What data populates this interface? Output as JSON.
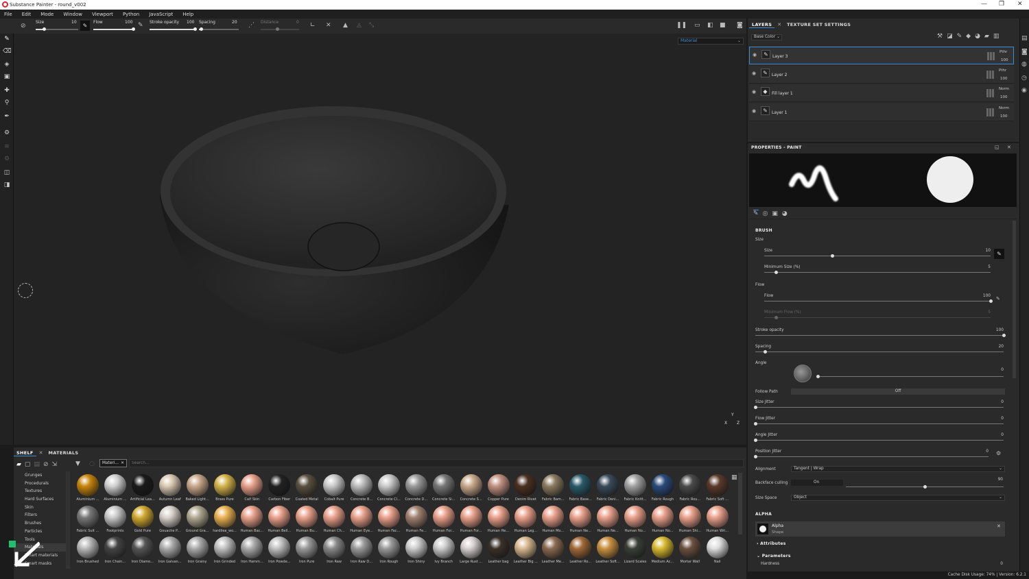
{
  "title_bar": {
    "title": "Substance Painter - round_v002",
    "minimize": "—",
    "maximize": "❐",
    "close": "✕"
  },
  "menu": [
    "File",
    "Edit",
    "Mode",
    "Window",
    "Viewport",
    "Python",
    "JavaScript",
    "Help"
  ],
  "toolbar": {
    "size_label": "Size",
    "size_value": "10",
    "size_level": 0.2,
    "flow_label": "Flow",
    "flow_value": "100",
    "flow_level": 1.0,
    "stroke_opacity_label": "Stroke opacity",
    "stroke_opacity_value": "100",
    "stroke_opacity_level": 1.0,
    "spacing_label": "Spacing",
    "spacing_value": "20",
    "spacing_level": 0.05,
    "distance_label": "Distance",
    "distance_value": "0"
  },
  "viewport": {
    "mode_select": "Material",
    "gizmo_y": "Y",
    "gizmo_x": "X",
    "gizmo_z": "Z"
  },
  "layers_panel": {
    "tab_layers": "LAYERS",
    "tab_texture_set": "TEXTURE SET SETTINGS",
    "channel_select": "Base Color",
    "layers": [
      {
        "name": "Layer 3",
        "blend": "Pthr",
        "opacity": "100",
        "selected": true,
        "type": "paint"
      },
      {
        "name": "Layer 2",
        "blend": "Pthr",
        "opacity": "100",
        "selected": false,
        "type": "paint"
      },
      {
        "name": "Fill layer 1",
        "blend": "Norm",
        "opacity": "100",
        "selected": false,
        "type": "fill"
      },
      {
        "name": "Layer 1",
        "blend": "Norm",
        "opacity": "100",
        "selected": false,
        "type": "paint"
      }
    ]
  },
  "properties": {
    "header": "PROPERTIES - PAINT",
    "brush_header": "BRUSH",
    "size_group": "Size",
    "size": {
      "label": "Size",
      "value": "10",
      "level": 0.3
    },
    "min_size": {
      "label": "Minimum Size (%)",
      "value": "5",
      "level": 0.05
    },
    "flow_group": "Flow",
    "flow": {
      "label": "Flow",
      "value": "100",
      "level": 1.0
    },
    "min_flow": {
      "label": "Minimum Flow (%)",
      "value": "5",
      "level": 0.05
    },
    "stroke_opacity": {
      "label": "Stroke opacity",
      "value": "100",
      "level": 1.0
    },
    "spacing": {
      "label": "Spacing",
      "value": "20",
      "level": 0.04
    },
    "angle": {
      "label": "Angle",
      "value": "0",
      "level": 0.0
    },
    "follow_path": {
      "label": "Follow Path",
      "value": "Off"
    },
    "size_jitter": {
      "label": "Size Jitter",
      "value": "0",
      "level": 0.0
    },
    "flow_jitter": {
      "label": "Flow Jitter",
      "value": "0",
      "level": 0.0
    },
    "angle_jitter": {
      "label": "Angle Jitter",
      "value": "0",
      "level": 0.0
    },
    "position_jitter": {
      "label": "Position Jitter",
      "value": "0",
      "level": 0.0
    },
    "alignment": {
      "label": "Alignment",
      "value": "Tangent | Wrap"
    },
    "backface_culling": {
      "label": "Backface culling",
      "toggle": "On",
      "value": "90",
      "level": 0.5
    },
    "size_space": {
      "label": "Size Space",
      "value": "Object"
    },
    "alpha_header": "ALPHA",
    "alpha": {
      "name": "Alpha",
      "sub": "Shape"
    },
    "attributes": "Attributes",
    "parameters": "Parameters",
    "hardness": {
      "label": "Hardness",
      "value": "0"
    }
  },
  "shelf": {
    "tab_shelf": "SHELF",
    "tab_materials": "MATERIALS",
    "filter_chip": "Materi...",
    "search_placeholder": "Search...",
    "categories": [
      "Grunges",
      "Procedurals",
      "Textures",
      "Hard Surfaces",
      "Skin",
      "Filters",
      "Brushes",
      "Particles",
      "Tools",
      "Materials",
      "Smart materials",
      "Smart masks"
    ],
    "selected_category": 9,
    "materials_row1": [
      "Aluminium ...",
      "Aluminium ...",
      "Artificial Lea...",
      "Autumn Leaf",
      "Baked Light...",
      "Brass Pure",
      "Calf Skin",
      "Carbon Fiber",
      "Coated Metal",
      "Cobalt Pure",
      "Concrete B...",
      "Concrete Cl...",
      "Concrete D...",
      "Concrete Si...",
      "Concrete S...",
      "Copper Pure",
      "Denim Rivet",
      "Fabric Bam...",
      "Fabric Base...",
      "Fabric Deni...",
      "Fabric Knitt...",
      "Fabric Rough",
      "Fabric Rou...",
      "Fabric Soft ..."
    ],
    "materials_row2": [
      "Fabric Suit ...",
      "Footprints",
      "Gold Pure",
      "Gouache P...",
      "Ground Gra...",
      "hardilea_wo...",
      "Human Bac...",
      "Human Bell...",
      "Human Bu...",
      "Human Ch...",
      "Human Eye...",
      "Human Fac...",
      "Human Fe...",
      "Human For...",
      "Human For...",
      "Human He...",
      "Human Leg...",
      "Human Mo...",
      "Human Ne...",
      "Human Ne...",
      "Human No...",
      "Human No...",
      "Human Shi...",
      "Human Wri..."
    ],
    "materials_row3": [
      "Iron Brushed",
      "Iron Chain...",
      "Iron Diamo...",
      "Iron Galvan...",
      "Iron Grainy",
      "Iron Grinded",
      "Iron Hamm...",
      "Iron Powde...",
      "Iron Pure",
      "Iron Raw",
      "Iron Raw D...",
      "Iron Rough",
      "Iron Shiny",
      "Ivy Branch",
      "Large Rust ...",
      "Leather bag",
      "Leather Big ...",
      "Leather Me...",
      "Leather Ro...",
      "Leather Soft...",
      "Lizard Scales",
      "Medium Ac...",
      "Mortar Wall",
      "Nail"
    ]
  },
  "status": {
    "text": "Cache Disk Usage:  74% | Version: 6.2.1"
  },
  "colors": {
    "accent": "#3b8fd8",
    "panel": "#2a2a2a",
    "viewport": "#232323"
  }
}
